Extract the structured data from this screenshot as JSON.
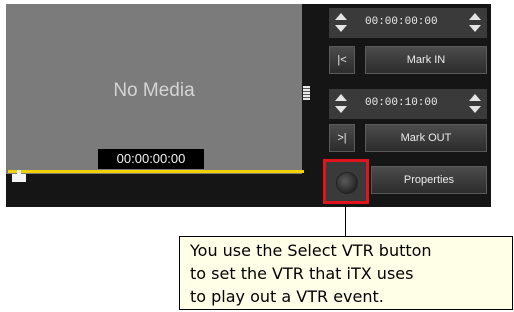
{
  "viewer": {
    "no_media_label": "No Media",
    "timecode": "00:00:00:00"
  },
  "in_point": {
    "timecode": "00:00:00:00",
    "goto_label": "|<",
    "mark_label": "Mark IN"
  },
  "out_point": {
    "timecode": "00:00:10:00",
    "goto_label": ">|",
    "mark_label": "Mark OUT"
  },
  "select_vtr": {
    "icon": "record-dot-icon"
  },
  "properties_label": "Properties",
  "callout": {
    "lines": [
      "You use the Select VTR button",
      "to set the VTR that iTX uses",
      "to play out a VTR event."
    ]
  },
  "colors": {
    "panel_bg": "#151515",
    "viewer_bg": "#7b7b7b",
    "scrub_line": "#f1d100",
    "highlight_border": "#e0141c",
    "callout_bg": "#ffffe8"
  }
}
